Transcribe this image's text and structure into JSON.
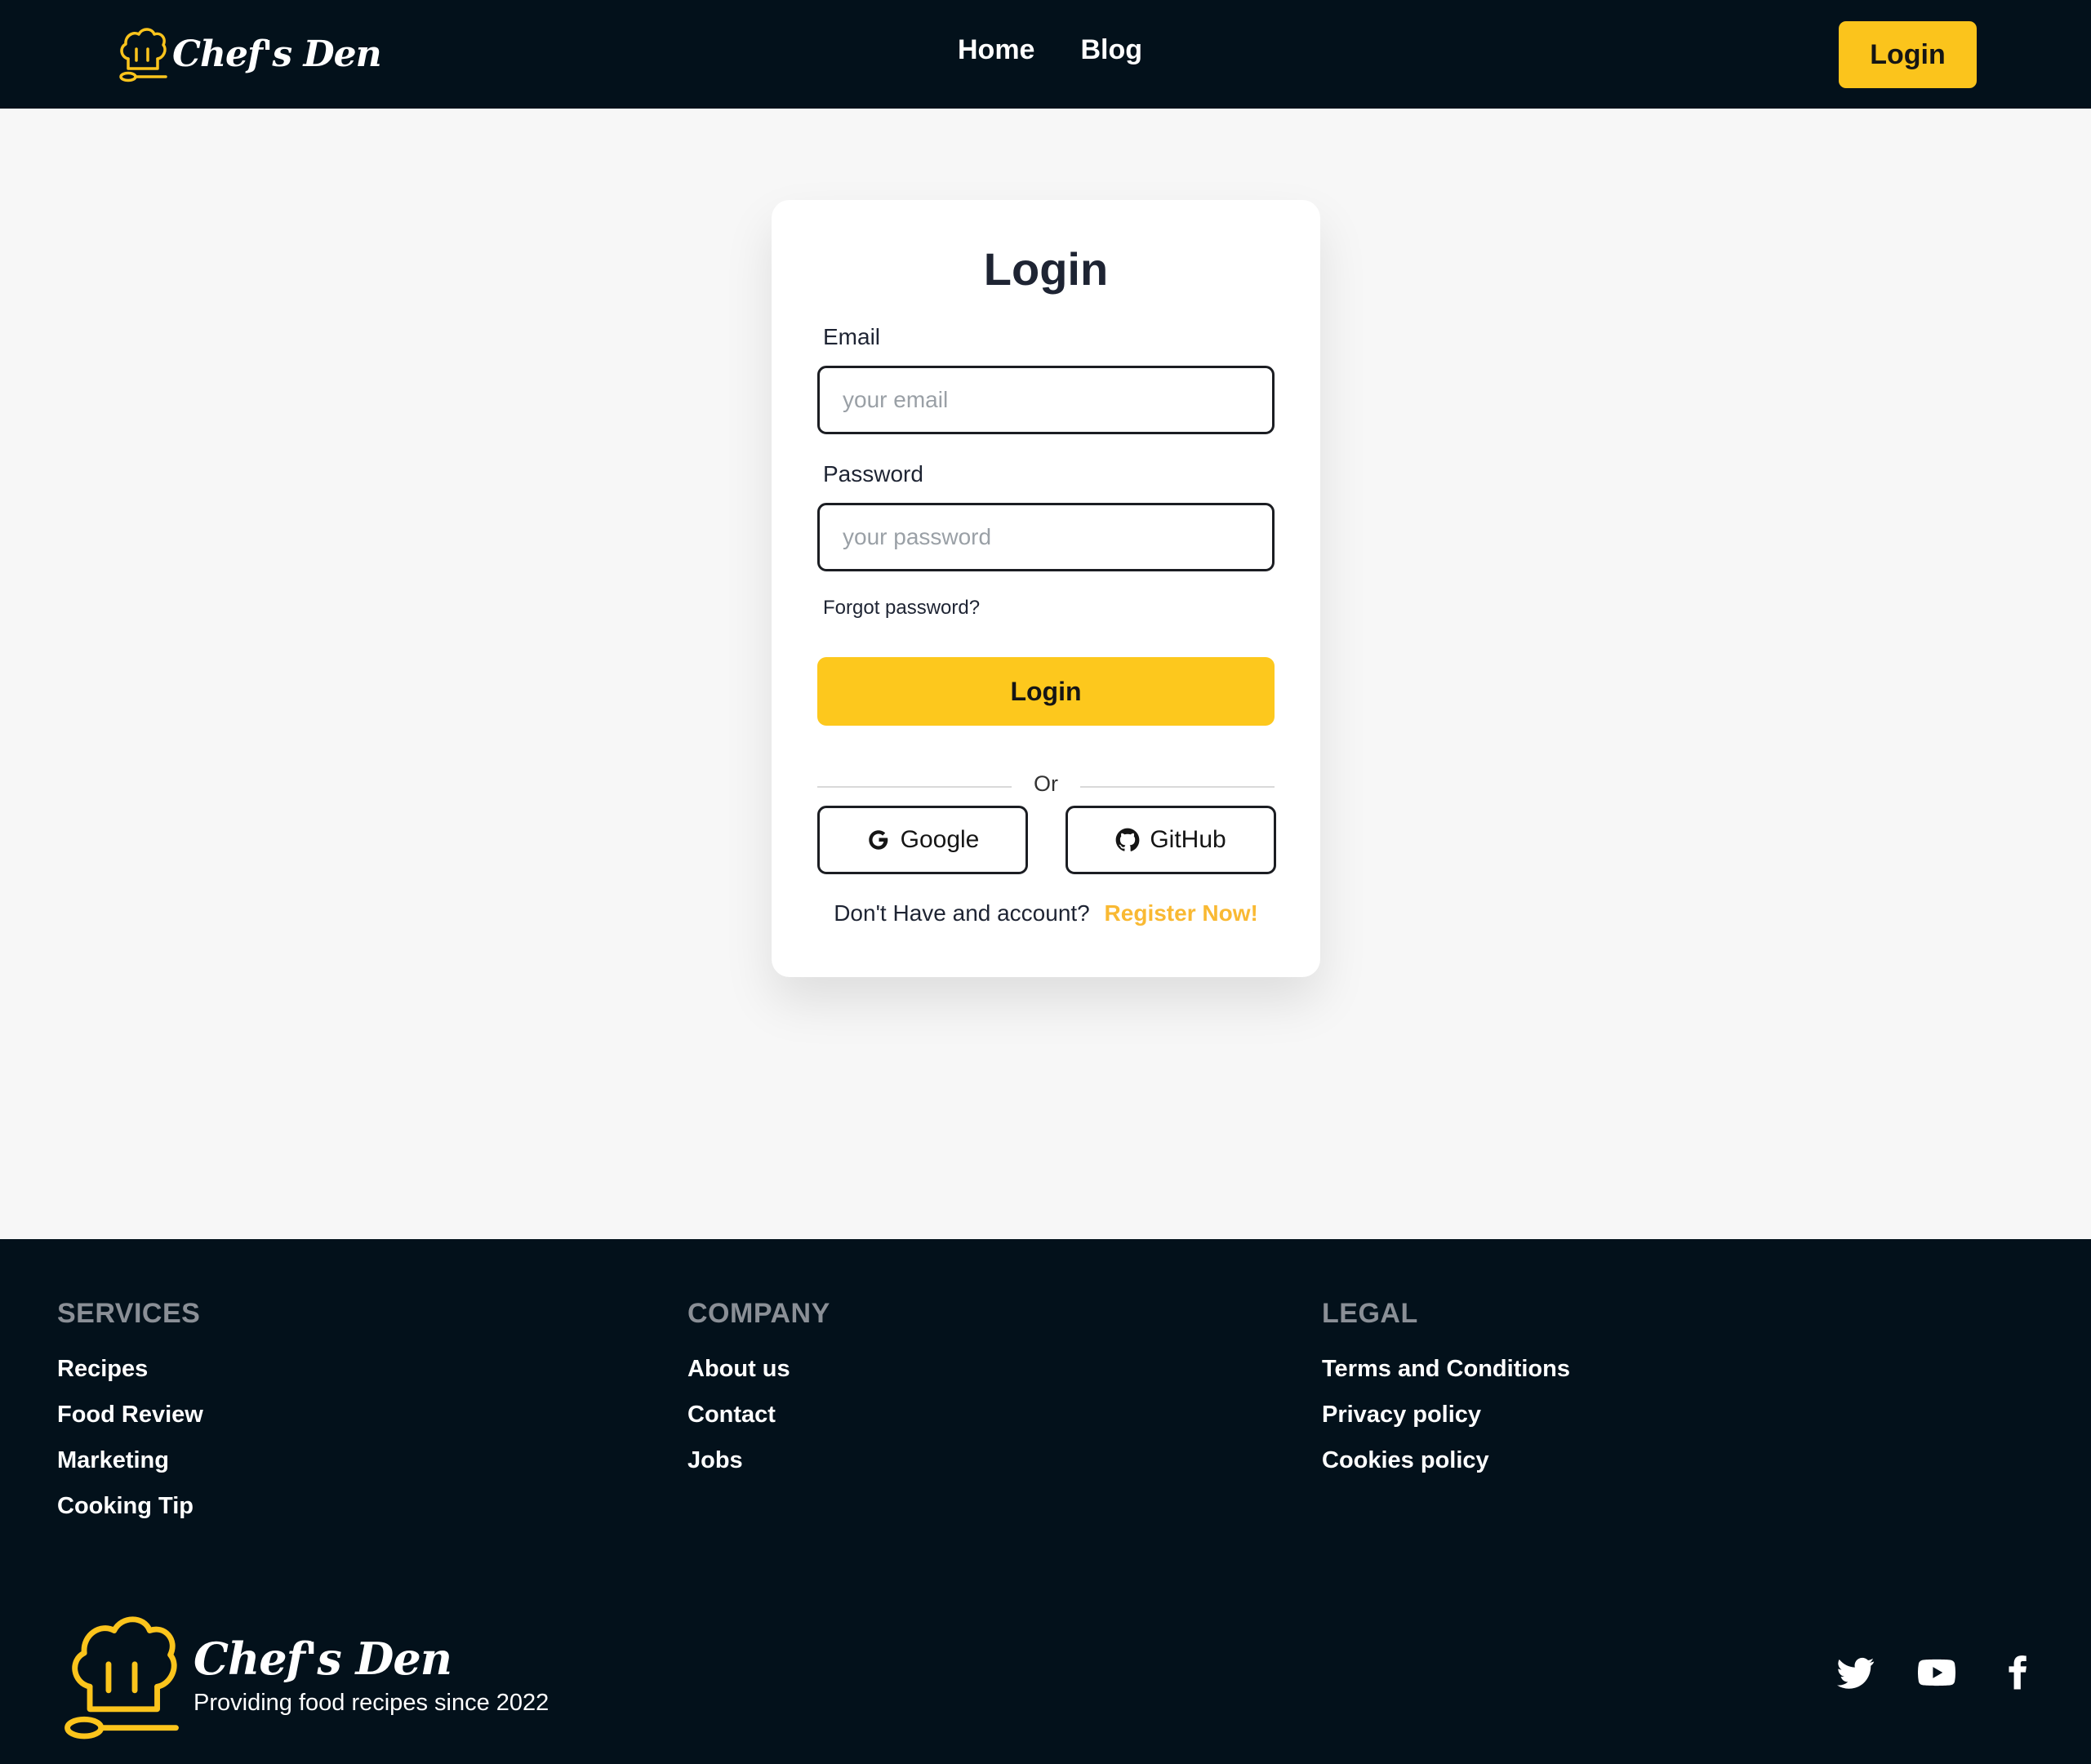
{
  "navbar": {
    "brand": "Chef's Den",
    "links": [
      "Home",
      "Blog"
    ],
    "login_label": "Login"
  },
  "login_card": {
    "title": "Login",
    "email_label": "Email",
    "email_placeholder": "your email",
    "email_value": "",
    "password_label": "Password",
    "password_placeholder": "your password",
    "password_value": "",
    "forgot_label": "Forgot password?",
    "submit_label": "Login",
    "divider_text": "Or",
    "google_label": "Google",
    "github_label": "GitHub",
    "register_prompt": "Don't Have and account?",
    "register_link": "Register Now!"
  },
  "footer": {
    "services": {
      "title": "SERVICES",
      "links": [
        "Recipes",
        "Food Review",
        "Marketing",
        "Cooking Tip"
      ]
    },
    "company": {
      "title": "COMPANY",
      "links": [
        "About us",
        "Contact",
        "Jobs"
      ]
    },
    "legal": {
      "title": "LEGAL",
      "links": [
        "Terms and Conditions",
        "Privacy policy",
        "Cookies policy"
      ]
    },
    "brand": "Chef's Den",
    "tagline": "Providing food recipes since 2022",
    "social_icons": [
      "twitter-icon",
      "youtube-icon",
      "facebook-icon"
    ]
  },
  "colors": {
    "dark": "#03111b",
    "accent": "#fdc81d",
    "register_link": "#f9b933",
    "background": "#f7f7f7"
  }
}
